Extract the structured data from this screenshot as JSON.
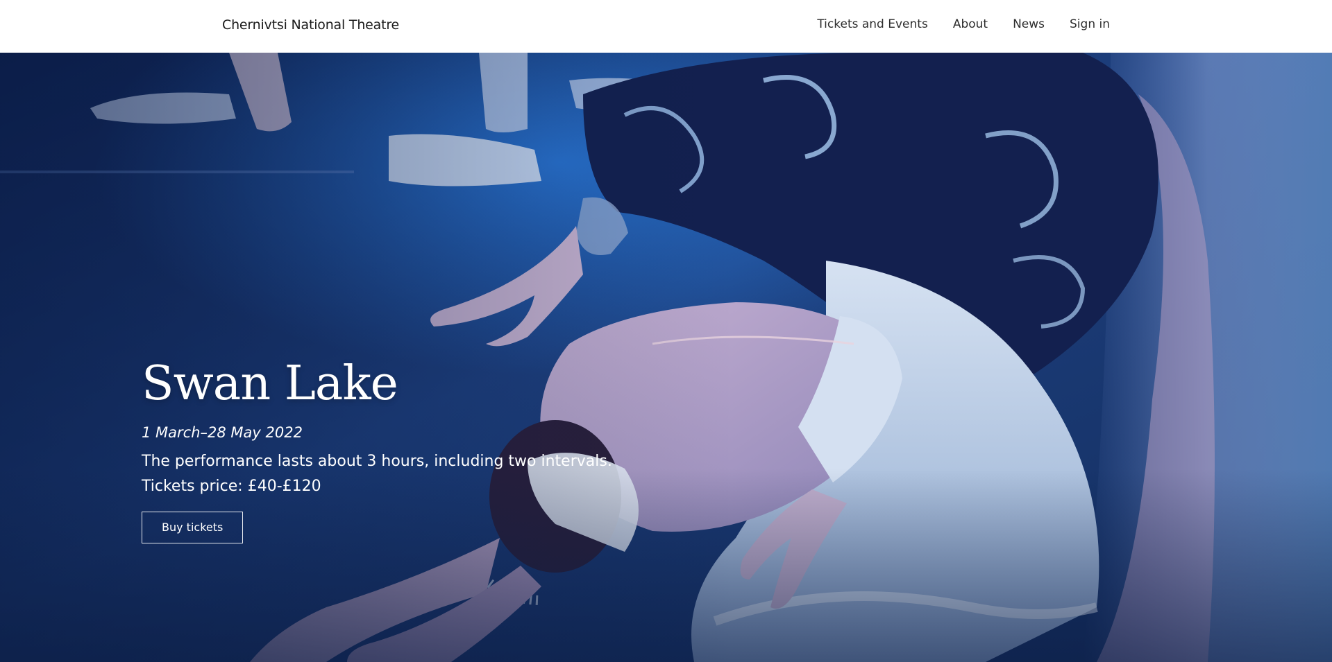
{
  "header": {
    "brand": "Chernivtsi National Theatre",
    "nav": [
      {
        "label": "Tickets and Events"
      },
      {
        "label": "About"
      },
      {
        "label": "News"
      },
      {
        "label": "Sign in"
      }
    ]
  },
  "hero": {
    "title": "Swan Lake",
    "dates": "1 March–28 May 2022",
    "description_line1": "The performance lasts about 3 hours, including two intervals.",
    "description_line2": "Tickets price: £40-£120",
    "button_label": "Buy tickets",
    "image_subject": "ballet-dancers-photo"
  },
  "colors": {
    "header_bg": "#ffffff",
    "hero_tint": "#13295a",
    "hero_text": "#ffffff"
  }
}
